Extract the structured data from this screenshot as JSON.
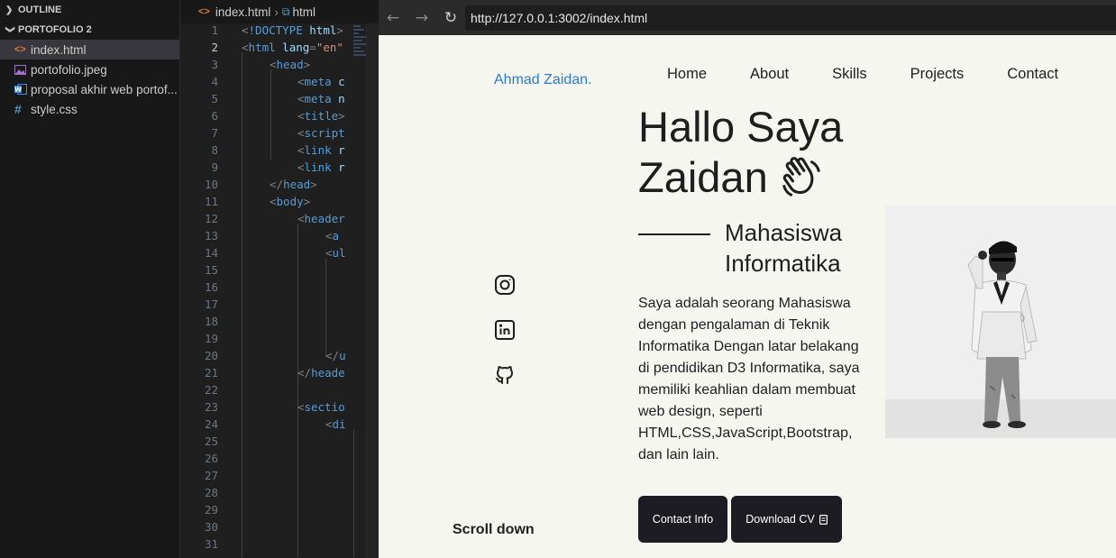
{
  "explorer": {
    "outline_label": "OUTLINE",
    "folder_label": "PORTOFOLIO 2",
    "files": [
      {
        "name": "index.html",
        "icon": "html-file-icon"
      },
      {
        "name": "portofolio.jpeg",
        "icon": "image-file-icon"
      },
      {
        "name": "proposal akhir web portof...",
        "icon": "word-file-icon"
      },
      {
        "name": "style.css",
        "icon": "css-file-icon"
      }
    ]
  },
  "editor": {
    "breadcrumb_file": "index.html",
    "breadcrumb_symbol": "html",
    "current_line": 2
  },
  "browser": {
    "url": "http://127.0.0.1:3002/index.html"
  },
  "site": {
    "logo": "Ahmad Zaidan.",
    "nav": [
      "Home",
      "About",
      "Skills",
      "Projects",
      "Contact"
    ],
    "hero_line1": "Hallo Saya",
    "hero_line2": "Zaidan",
    "subtitle_line1": "Mahasiswa",
    "subtitle_line2": "Informatika",
    "description": "Saya adalah seorang Mahasiswa dengan pengalaman di Teknik Informatika Dengan latar belakang di pendidikan D3 Informatika, saya memiliki keahlian dalam membuat web design, seperti HTML,CSS,JavaScript,Bootstrap, dan lain lain.",
    "contact_button": "Contact Info",
    "cv_button": "Download CV",
    "scroll_down": "Scroll down",
    "social": [
      "instagram-icon",
      "linkedin-icon",
      "github-icon"
    ]
  }
}
